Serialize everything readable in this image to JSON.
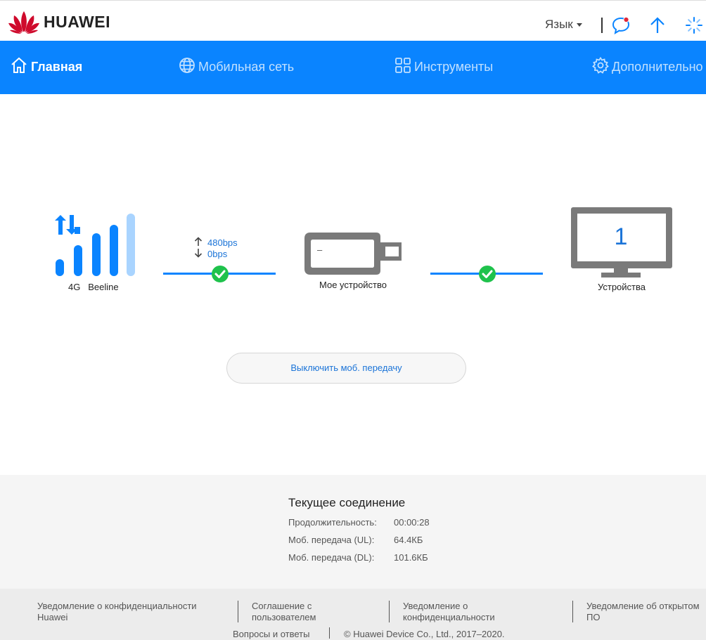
{
  "header": {
    "brand": "HUAWEI",
    "language_label": "Язык",
    "icons": [
      "huawei-logo-icon",
      "messages-icon",
      "update-icon",
      "loading-icon"
    ],
    "colors": {
      "brand_red": "#cf0a2c",
      "accent_blue": "#0a84ff",
      "notify_red": "#e0283a"
    }
  },
  "nav": {
    "items": [
      {
        "label": "Главная",
        "icon": "home-icon",
        "active": true
      },
      {
        "label": "Мобильная сеть",
        "icon": "globe-icon",
        "active": false
      },
      {
        "label": "Инструменты",
        "icon": "grid-icon",
        "active": false
      },
      {
        "label": "Дополнительно",
        "icon": "gear-icon",
        "active": false
      }
    ]
  },
  "status": {
    "network_type": "4G",
    "operator": "Beeline",
    "upload_rate": "480bps",
    "download_rate": "0bps",
    "dongle_text": "–",
    "my_device_label": "Мое устройство",
    "connected_devices_count": "1",
    "devices_label": "Устройства",
    "signal_bars_active": 4,
    "signal_bars_total": 5
  },
  "toggle_button": {
    "label": "Выключить моб. передачу"
  },
  "connection": {
    "title": "Текущее соединение",
    "rows": [
      {
        "label": "Продолжительность:",
        "value": "00:00:28"
      },
      {
        "label": "Моб. передача (UL):",
        "value": "64.4КБ"
      },
      {
        "label": "Моб. передача (DL):",
        "value": "101.6КБ"
      }
    ]
  },
  "footer": {
    "links": [
      "Уведомление о конфиденциальности Huawei",
      "Соглашение с пользователем",
      "Уведомление о конфиденциальности",
      "Уведомление об открытом ПО"
    ],
    "faq": "Вопросы и ответы",
    "copyright": "© Huawei Device Co., Ltd., 2017–2020."
  }
}
